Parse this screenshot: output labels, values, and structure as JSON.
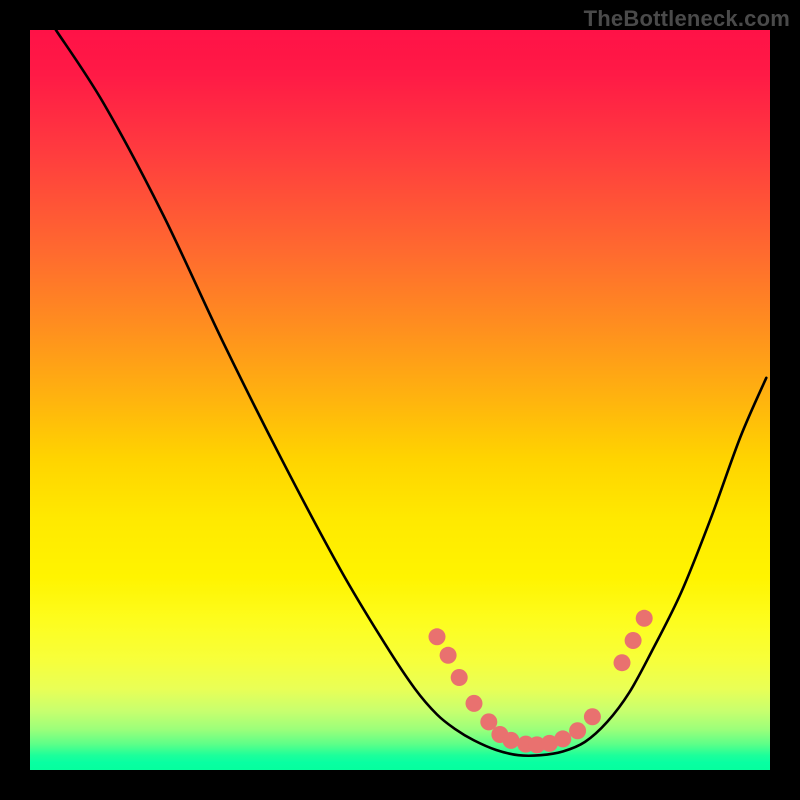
{
  "attribution": "TheBottleneck.com",
  "colors": {
    "frame": "#000000",
    "curve_stroke": "#000000",
    "marker_fill": "#e9716f",
    "marker_stroke": "#cc5a58"
  },
  "chart_data": {
    "type": "line",
    "title": "",
    "xlabel": "",
    "ylabel": "",
    "xlim": [
      0,
      100
    ],
    "ylim": [
      0,
      100
    ],
    "grid": false,
    "legend": false,
    "note": "x/y are visual percentages of the 740×740 plot area; y=0 is the top. The curve depicts a bottleneck V-shape reaching its minimum near the lower-middle, with salmon markers clustered near the trough.",
    "series": [
      {
        "name": "bottleneck-curve",
        "x": [
          3.5,
          10,
          18,
          26,
          34,
          42,
          48,
          52,
          55,
          57.5,
          60,
          63,
          66,
          69,
          72,
          75,
          78,
          81,
          84,
          88,
          92,
          96,
          99.5
        ],
        "y": [
          0,
          10,
          25,
          42,
          58,
          73,
          83,
          89,
          92.5,
          94.5,
          96,
          97.3,
          98,
          98,
          97.5,
          96.2,
          93.5,
          89.5,
          84,
          76,
          66,
          55,
          47
        ]
      }
    ],
    "markers": [
      {
        "x": 55.0,
        "y": 82.0
      },
      {
        "x": 56.5,
        "y": 84.5
      },
      {
        "x": 58.0,
        "y": 87.5
      },
      {
        "x": 60.0,
        "y": 91.0
      },
      {
        "x": 62.0,
        "y": 93.5
      },
      {
        "x": 63.5,
        "y": 95.2
      },
      {
        "x": 65.0,
        "y": 96.0
      },
      {
        "x": 67.0,
        "y": 96.5
      },
      {
        "x": 68.5,
        "y": 96.6
      },
      {
        "x": 70.2,
        "y": 96.4
      },
      {
        "x": 72.0,
        "y": 95.8
      },
      {
        "x": 74.0,
        "y": 94.7
      },
      {
        "x": 76.0,
        "y": 92.8
      },
      {
        "x": 80.0,
        "y": 85.5
      },
      {
        "x": 81.5,
        "y": 82.5
      },
      {
        "x": 83.0,
        "y": 79.5
      }
    ]
  }
}
